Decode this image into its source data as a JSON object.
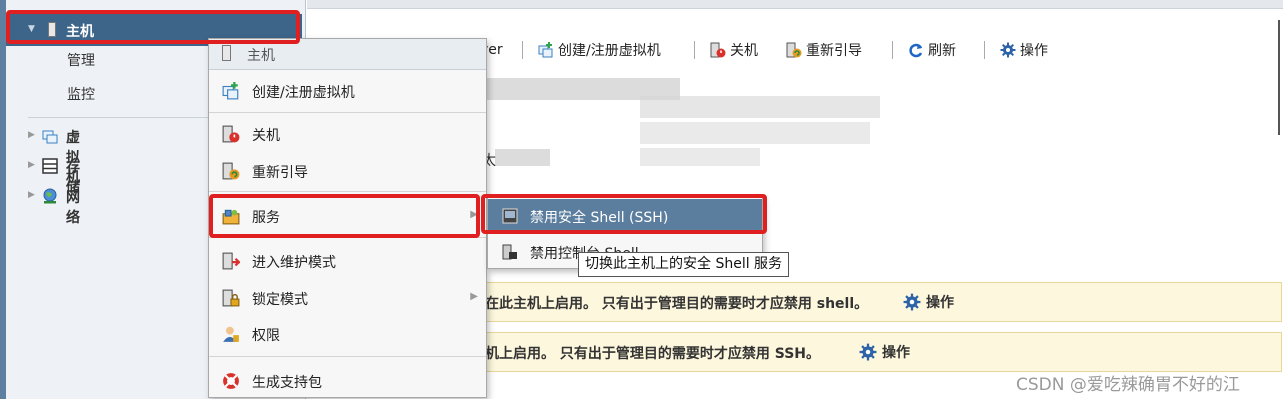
{
  "sidebar": {
    "host_label": "主机",
    "sub_items": [
      "管理",
      "监控"
    ],
    "items": [
      {
        "label": "虚拟机",
        "icon": "vm-icon"
      },
      {
        "label": "存储",
        "icon": "storage-icon"
      },
      {
        "label": "网络",
        "icon": "network-icon"
      }
    ]
  },
  "toolbar": {
    "partial_label": "ver",
    "create_vm": "创建/注册虚拟机",
    "shutdown": "关机",
    "reboot": "重新引导",
    "refresh": "刷新",
    "actions": "操作"
  },
  "background_text": {
    "frag1": "：",
    "frag2": "太"
  },
  "notices": [
    {
      "text": "在此主机上启用。 只有出于管理目的需要时才应禁用 shell。",
      "action": "操作"
    },
    {
      "text": "机上启用。 只有出于管理目的需要时才应禁用 SSH。",
      "action": "操作"
    }
  ],
  "context_menu": {
    "header": "主机",
    "items": [
      {
        "label": "创建/注册虚拟机",
        "icon": "create-vm-icon"
      },
      {
        "label": "关机",
        "icon": "power-off-icon"
      },
      {
        "label": "重新引导",
        "icon": "reboot-icon"
      },
      {
        "label": "服务",
        "icon": "services-icon"
      },
      {
        "label": "进入维护模式",
        "icon": "maintenance-icon"
      },
      {
        "label": "锁定模式",
        "icon": "lock-icon"
      },
      {
        "label": "权限",
        "icon": "permissions-icon"
      },
      {
        "label": "生成支持包",
        "icon": "support-bundle-icon"
      }
    ]
  },
  "submenu": {
    "items": [
      {
        "label": "禁用安全 Shell (SSH)",
        "icon": "ssh-icon"
      },
      {
        "label": "禁用控制台 Shell",
        "icon": "console-shell-icon"
      }
    ]
  },
  "tooltip": "切换此主机上的安全 Shell 服务",
  "watermark": "CSDN @爱吃辣确胃不好的江",
  "colors": {
    "selection_blue": "#3d6489",
    "submenu_active": "#5b7d9e",
    "highlight_red": "#e02020",
    "notice_bg": "#fdf7dd"
  }
}
